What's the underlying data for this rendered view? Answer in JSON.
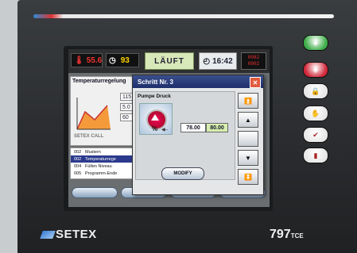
{
  "topbar": {
    "temp_value": "55.6",
    "counter_value": "93",
    "status_label": "LÄUFT",
    "clock_value": "16:42",
    "step_small_top": "0082",
    "step_small_bottom": "0002"
  },
  "leftpanel": {
    "title": "Temperaturregelung",
    "values": [
      "115",
      "5.0",
      "60"
    ],
    "call_label": "SETEX CALL"
  },
  "program_list": [
    {
      "num": "002",
      "name": "Mustern",
      "selected": false
    },
    {
      "num": "002",
      "name": "Temperaturrege",
      "selected": true
    },
    {
      "num": "004",
      "name": "Füllen Niveau",
      "selected": false
    },
    {
      "num": "005",
      "name": "Programm-Ende",
      "selected": false
    }
  ],
  "dialog": {
    "title": "Schritt Nr. 3",
    "close_label": "✕",
    "section_label": "Pumpe Druck",
    "unit": "%",
    "actual_value": "78.00",
    "set_value": "80.00",
    "modify_label": "MODIFY",
    "scroll_buttons": [
      "⏫",
      "▲",
      "",
      "▼",
      "⏬"
    ]
  },
  "device": {
    "brand": "SETEX",
    "model": "797",
    "model_suffix": "TCE"
  },
  "side_buttons": [
    {
      "icon": "start-icon",
      "color": "#3fae4a",
      "glyph": "◈"
    },
    {
      "icon": "stop-icon",
      "color": "#d0283a",
      "glyph": "◈"
    },
    {
      "icon": "hand-lock-icon",
      "color": "#e7e7e7",
      "glyph": "🔒"
    },
    {
      "icon": "hand-stop-icon",
      "color": "#e7e7e7",
      "glyph": "✋"
    },
    {
      "icon": "check-icon",
      "color": "#e7e7e7",
      "glyph": "✔"
    },
    {
      "icon": "door-icon",
      "color": "#e7e7e7",
      "glyph": "▮"
    }
  ]
}
